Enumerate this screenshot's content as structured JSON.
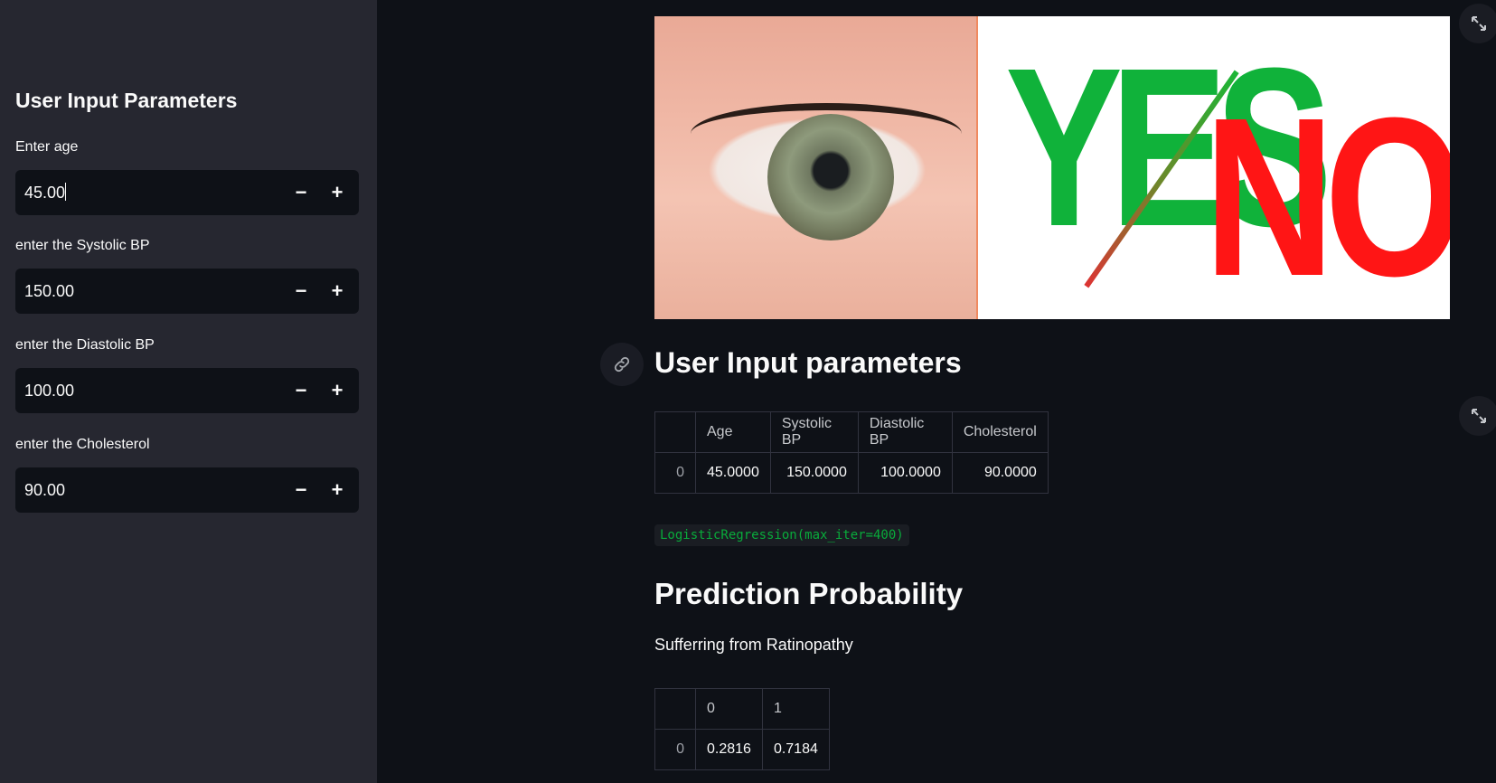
{
  "sidebar": {
    "title": "User Input Parameters",
    "inputs": [
      {
        "label": "Enter age",
        "value": "45.00"
      },
      {
        "label": "enter the Systolic BP",
        "value": "150.00"
      },
      {
        "label": "enter the Diastolic BP",
        "value": "100.00"
      },
      {
        "label": "enter the Cholesterol",
        "value": "90.00"
      }
    ],
    "minus_glyph": "−",
    "plus_glyph": "+"
  },
  "banner": {
    "yes_text": "YES",
    "no_text": "NO"
  },
  "main": {
    "section_title": "User Input parameters",
    "input_table": {
      "columns": [
        "",
        "Age",
        "Systolic BP",
        "Diastolic BP",
        "Cholesterol"
      ],
      "rows": [
        [
          "0",
          "45.0000",
          "150.0000",
          "100.0000",
          "90.0000"
        ]
      ]
    },
    "model_code": "LogisticRegression(max_iter=400)",
    "prediction_title": "Prediction Probability",
    "prediction_text": "Sufferring from Ratinopathy",
    "prob_table": {
      "columns": [
        "",
        "0",
        "1"
      ],
      "rows": [
        [
          "0",
          "0.2816",
          "0.7184"
        ]
      ]
    }
  },
  "colors": {
    "app_bg": "#0e1117",
    "sidebar_bg": "#262730",
    "code_green": "#09ab3b",
    "yes_green": "#10b23a",
    "no_red": "#ff1515"
  },
  "icons": [
    "link-icon",
    "expand-icon"
  ]
}
